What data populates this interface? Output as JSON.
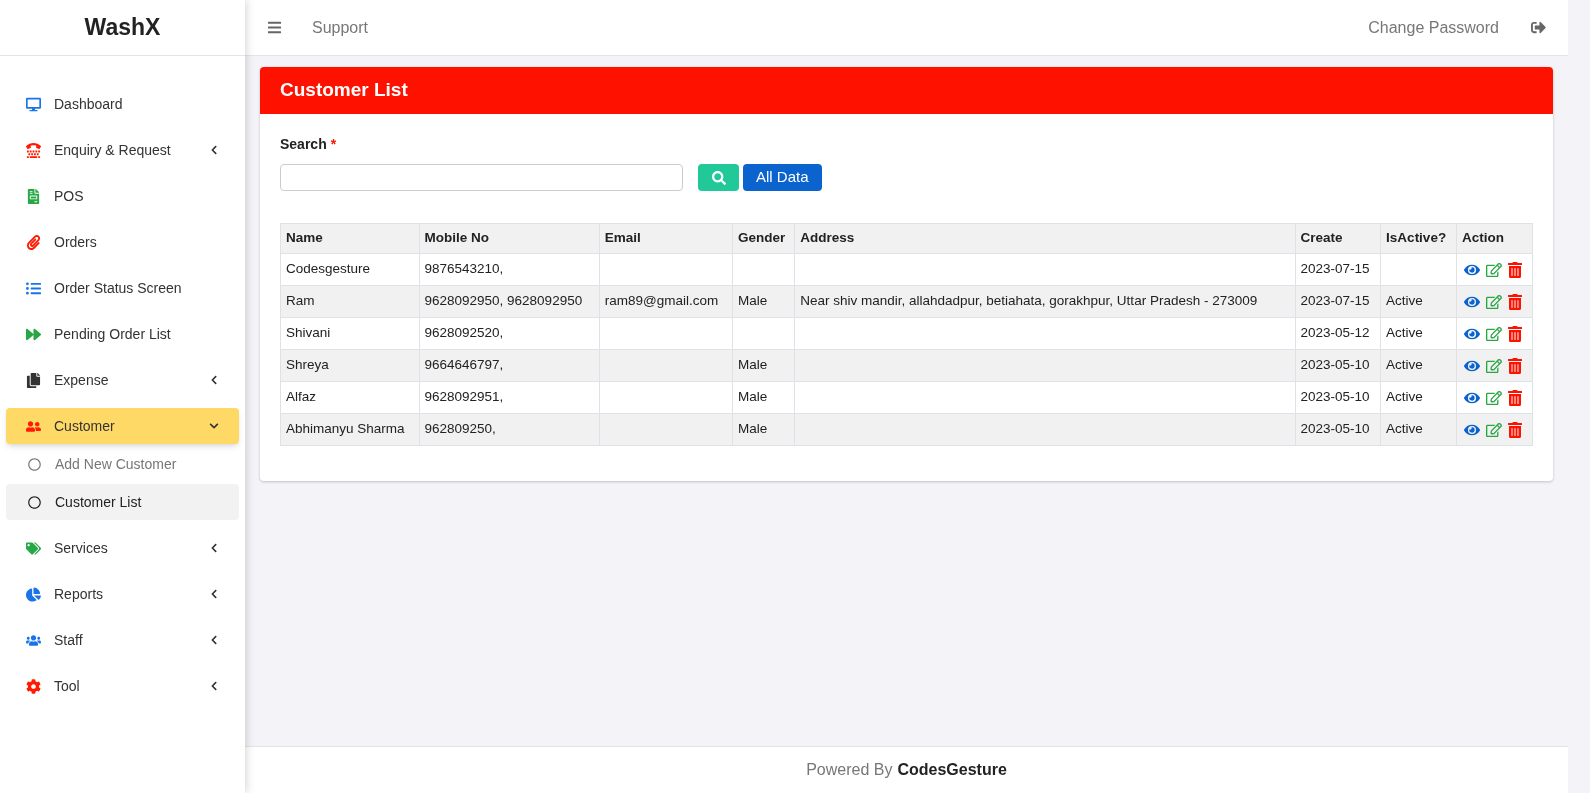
{
  "brand": "WashX",
  "sidebar": {
    "items": [
      {
        "label": "Dashboard",
        "kind": "link",
        "selected": false
      },
      {
        "label": "Enquiry & Request",
        "kind": "group",
        "expanded": false,
        "selected": false
      },
      {
        "label": "POS",
        "kind": "link",
        "selected": false
      },
      {
        "label": "Orders",
        "kind": "link",
        "selected": false
      },
      {
        "label": "Order Status Screen",
        "kind": "link",
        "selected": false
      },
      {
        "label": "Pending Order List",
        "kind": "link",
        "selected": false
      },
      {
        "label": "Expense",
        "kind": "group",
        "expanded": false,
        "selected": false
      },
      {
        "label": "Customer",
        "kind": "group",
        "expanded": true,
        "selected": true,
        "children": [
          {
            "label": "Add New Customer",
            "selected": false
          },
          {
            "label": "Customer List",
            "selected": true
          }
        ]
      },
      {
        "label": "Services",
        "kind": "group",
        "expanded": false,
        "selected": false
      },
      {
        "label": "Reports",
        "kind": "group",
        "expanded": false,
        "selected": false
      },
      {
        "label": "Staff",
        "kind": "group",
        "expanded": false,
        "selected": false
      },
      {
        "label": "Tool",
        "kind": "group",
        "expanded": false,
        "selected": false
      }
    ]
  },
  "topbar": {
    "link": "Support",
    "change_password": "Change Password"
  },
  "card": {
    "title": "Customer List",
    "search_label": "Search",
    "required_mark": "*",
    "all_data_button": "All Data"
  },
  "table": {
    "columns": [
      "Name",
      "Mobile No",
      "Email",
      "Gender",
      "Address",
      "Create",
      "IsActive?",
      "Action"
    ],
    "rows": [
      {
        "name": "Codesgesture",
        "mobile": "9876543210,",
        "create": "2023-07-15"
      },
      {
        "name": "Ram",
        "mobile": "9628092950, 9628092950",
        "email": "ram89@gmail.com",
        "gender": "Male",
        "address": "Near shiv mandir, allahdadpur, betiahata, gorakhpur, Uttar Pradesh - 273009",
        "create": "2023-07-15",
        "is_active": "Active"
      },
      {
        "name": "Shivani",
        "mobile": "9628092520,",
        "create": "2023-05-12",
        "is_active": "Active"
      },
      {
        "name": "Shreya",
        "mobile": "9664646797,",
        "gender": "Male",
        "create": "2023-05-10",
        "is_active": "Active"
      },
      {
        "name": "Alfaz",
        "mobile": "9628092951,",
        "gender": "Male",
        "create": "2023-05-10",
        "is_active": "Active"
      },
      {
        "name": "Abhimanyu Sharma",
        "mobile": "962809250,",
        "gender": "Male",
        "create": "2023-05-10",
        "is_active": "Active"
      }
    ]
  },
  "footer": {
    "prefix": "Powered By",
    "brand": "CodesGesture"
  }
}
